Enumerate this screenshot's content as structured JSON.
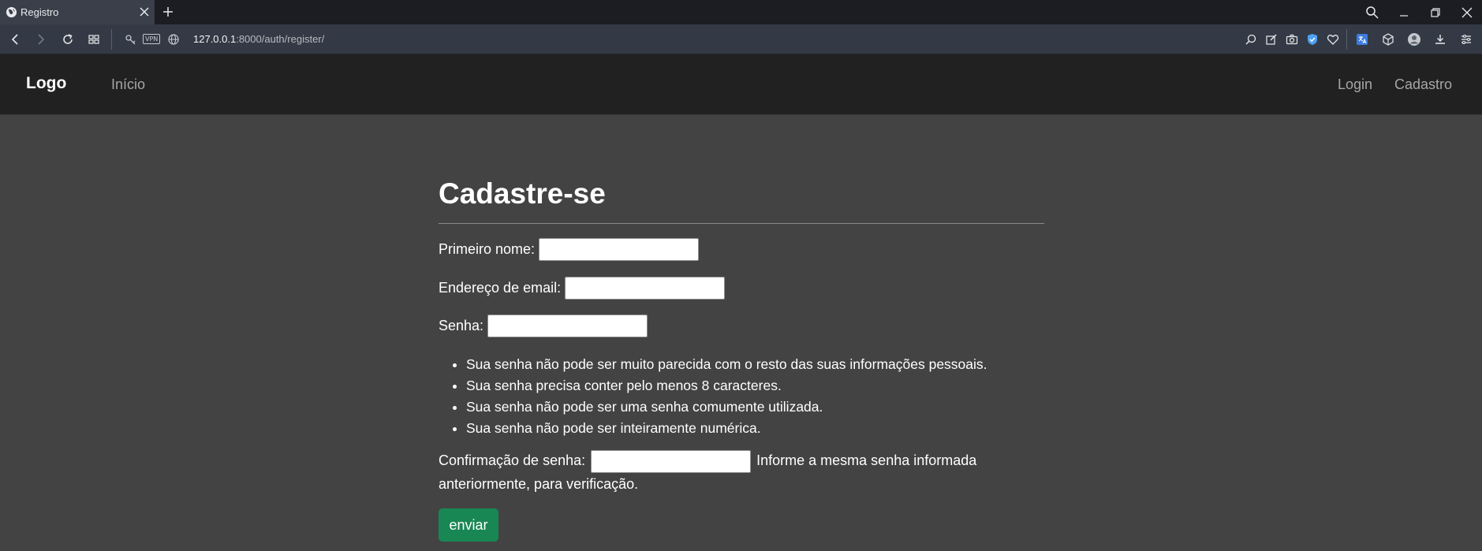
{
  "browser": {
    "tab_title": "Registro",
    "url_host": "127.0.0.1",
    "url_rest": ":8000/auth/register/",
    "vpn_label": "VPN"
  },
  "navbar": {
    "brand": "Logo",
    "home": "Início",
    "login": "Login",
    "register": "Cadastro"
  },
  "form": {
    "title": "Cadastre-se",
    "first_name_label": "Primeiro nome:",
    "first_name_value": "",
    "email_label": "Endereço de email:",
    "email_value": "",
    "password_label": "Senha:",
    "password_value": "",
    "password_help": [
      "Sua senha não pode ser muito parecida com o resto das suas informações pessoais.",
      "Sua senha precisa conter pelo menos 8 caracteres.",
      "Sua senha não pode ser uma senha comumente utilizada.",
      "Sua senha não pode ser inteiramente numérica."
    ],
    "confirm_label": "Confirmação de senha:",
    "confirm_value": "",
    "confirm_help": "Informe a mesma senha informada anteriormente, para verificação.",
    "submit_label": "enviar"
  },
  "colors": {
    "page_bg": "#434343",
    "navbar_bg": "#212121",
    "submit_bg": "#198754"
  }
}
